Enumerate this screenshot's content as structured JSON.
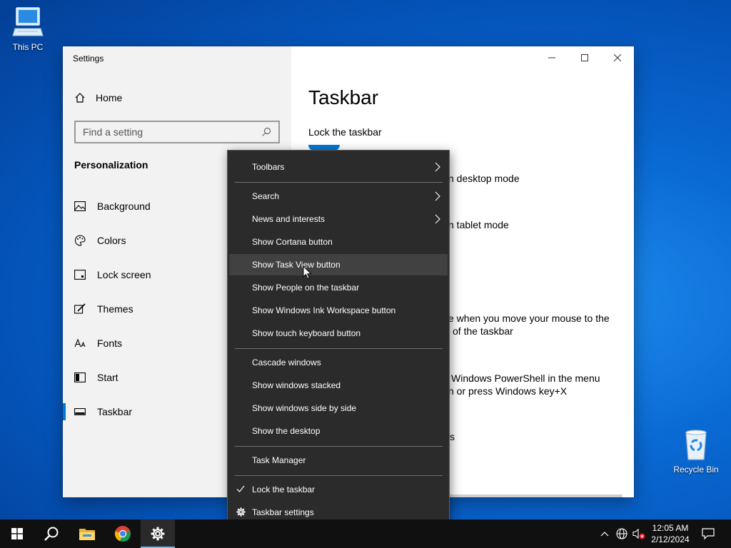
{
  "desktop": {
    "icons": [
      {
        "label": "This PC"
      },
      {
        "label": "Recycle Bin"
      }
    ]
  },
  "window": {
    "title": "Settings",
    "home_label": "Home",
    "search_placeholder": "Find a setting",
    "section_label": "Personalization",
    "nav_items": [
      {
        "label": "Background",
        "icon": "image-icon"
      },
      {
        "label": "Colors",
        "icon": "palette-icon"
      },
      {
        "label": "Lock screen",
        "icon": "lock-screen-icon"
      },
      {
        "label": "Themes",
        "icon": "brush-icon"
      },
      {
        "label": "Fonts",
        "icon": "font-icon"
      },
      {
        "label": "Start",
        "icon": "start-icon"
      },
      {
        "label": "Taskbar",
        "icon": "taskbar-icon",
        "active": true
      }
    ],
    "page_title": "Taskbar",
    "content_texts": {
      "lock_taskbar": "Lock the taskbar",
      "desktop_mode": "n desktop mode",
      "tablet_mode": "n tablet mode",
      "peek_line1": "e when you move your mouse to the",
      "peek_line2": "of the taskbar",
      "powershell_line1": "Windows PowerShell in the menu",
      "powershell_line2": "n or press Windows key+X",
      "partial_s": "s"
    }
  },
  "context_menu": {
    "items": [
      {
        "label": "Toolbars",
        "submenu": true
      },
      {
        "label": "Search",
        "submenu": true
      },
      {
        "label": "News and interests",
        "submenu": true
      },
      {
        "label": "Show Cortana button"
      },
      {
        "label": "Show Task View button",
        "hovered": true
      },
      {
        "label": "Show People on the taskbar"
      },
      {
        "label": "Show Windows Ink Workspace button"
      },
      {
        "label": "Show touch keyboard button"
      },
      {
        "label": "Cascade windows"
      },
      {
        "label": "Show windows stacked"
      },
      {
        "label": "Show windows side by side"
      },
      {
        "label": "Show the desktop"
      },
      {
        "label": "Task Manager"
      },
      {
        "label": "Lock the taskbar",
        "checked": true
      },
      {
        "label": "Taskbar settings",
        "icon": "gear-icon"
      }
    ]
  },
  "taskbar": {
    "time": "12:05 AM",
    "date": "2/12/2024"
  },
  "colors": {
    "accent": "#0078d7",
    "menu_bg": "#2b2b2b",
    "taskbar_bg": "#101010"
  }
}
